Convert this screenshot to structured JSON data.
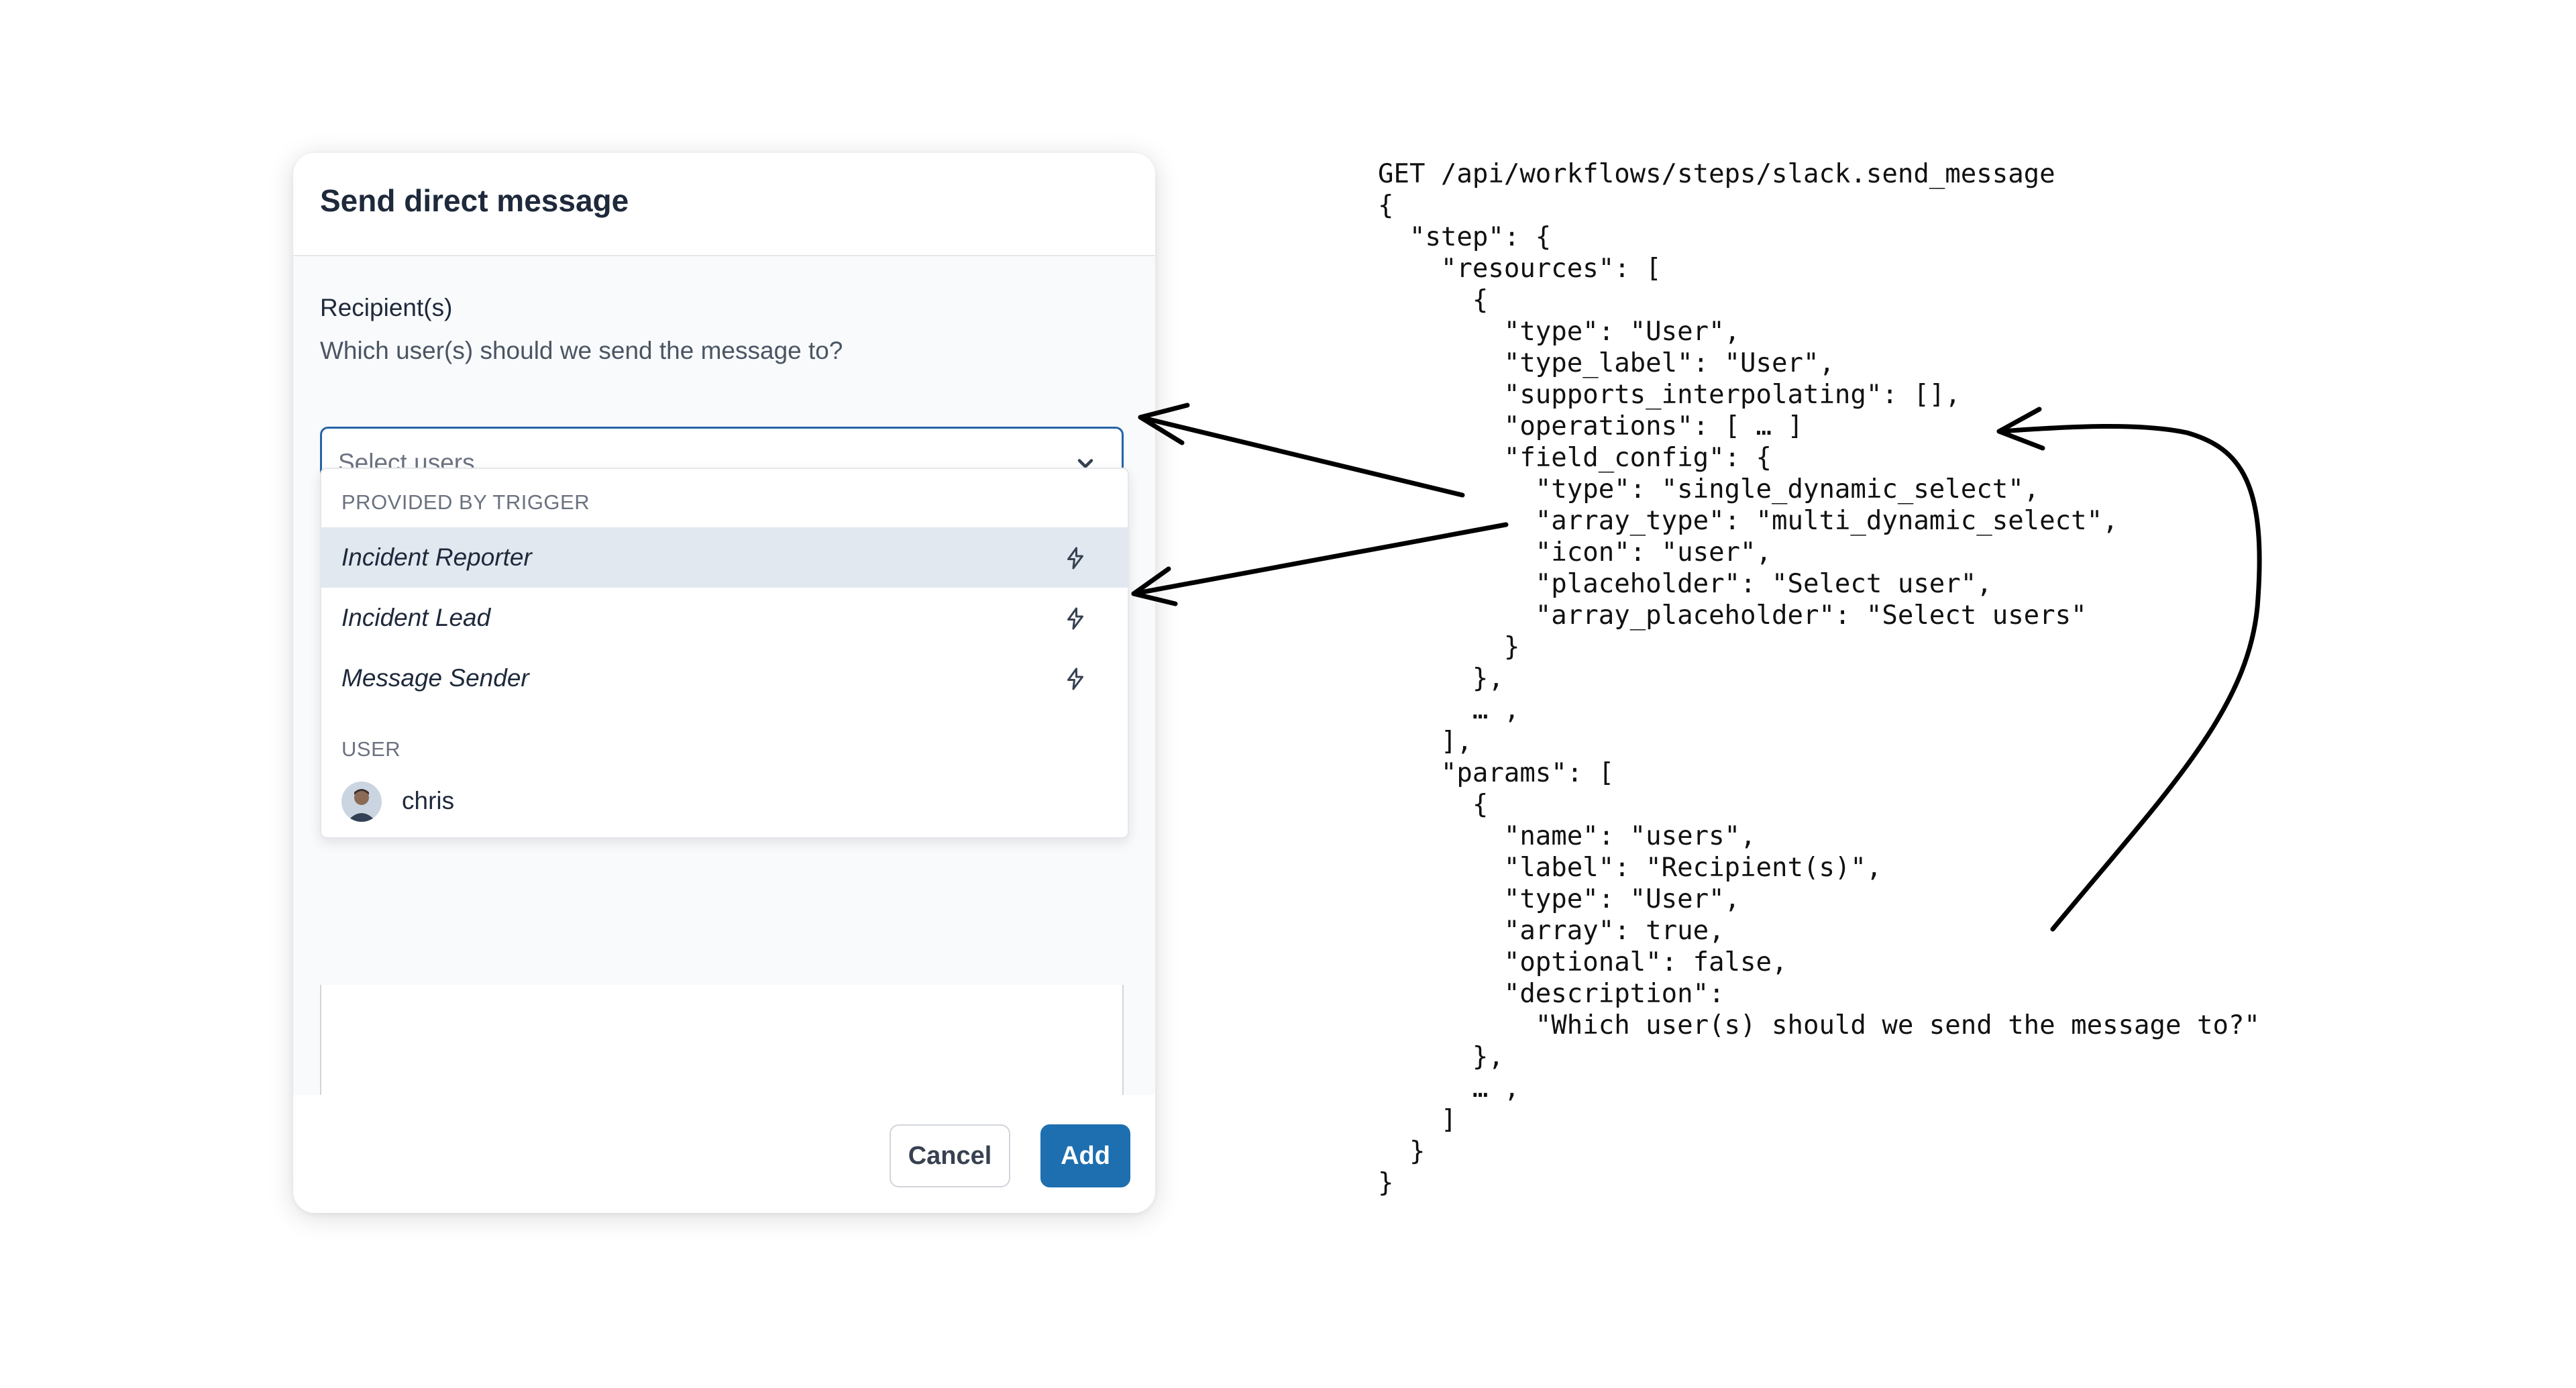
{
  "modal": {
    "title": "Send direct message",
    "field": {
      "label": "Recipient(s)",
      "help": "Which user(s) should we send the message to?",
      "placeholder": "Select users"
    },
    "dropdown": {
      "group_trigger": "PROVIDED BY TRIGGER",
      "options": [
        {
          "label": "Incident Reporter",
          "highlighted": true
        },
        {
          "label": "Incident Lead"
        },
        {
          "label": "Message Sender"
        }
      ],
      "group_user": "USER",
      "users": [
        {
          "label": "chris"
        }
      ]
    },
    "footer": {
      "cancel_label": "Cancel",
      "add_label": "Add"
    }
  },
  "code": {
    "lines": [
      "GET /api/workflows/steps/slack.send_message",
      "{",
      "  \"step\": {",
      "    \"resources\": [",
      "      {",
      "        \"type\": \"User\",",
      "        \"type_label\": \"User\",",
      "        \"supports_interpolating\": [],",
      "        \"operations\": [ … ]",
      "        \"field_config\": {",
      "          \"type\": \"single_dynamic_select\",",
      "          \"array_type\": \"multi_dynamic_select\",",
      "          \"icon\": \"user\",",
      "          \"placeholder\": \"Select user\",",
      "          \"array_placeholder\": \"Select users\"",
      "        }",
      "      },",
      "      … ,",
      "    ],",
      "    \"params\": [",
      "      {",
      "        \"name\": \"users\",",
      "        \"label\": \"Recipient(s)\",",
      "        \"type\": \"User\",",
      "        \"array\": true,",
      "        \"optional\": false,",
      "        \"description\":",
      "          \"Which user(s) should we send the message to?\"",
      "      },",
      "      … ,",
      "    ]",
      "  }",
      "}"
    ]
  },
  "colors": {
    "accent": "#1d6fb0",
    "focus_border": "#2563a8",
    "highlight_row": "#e2e8f0"
  }
}
